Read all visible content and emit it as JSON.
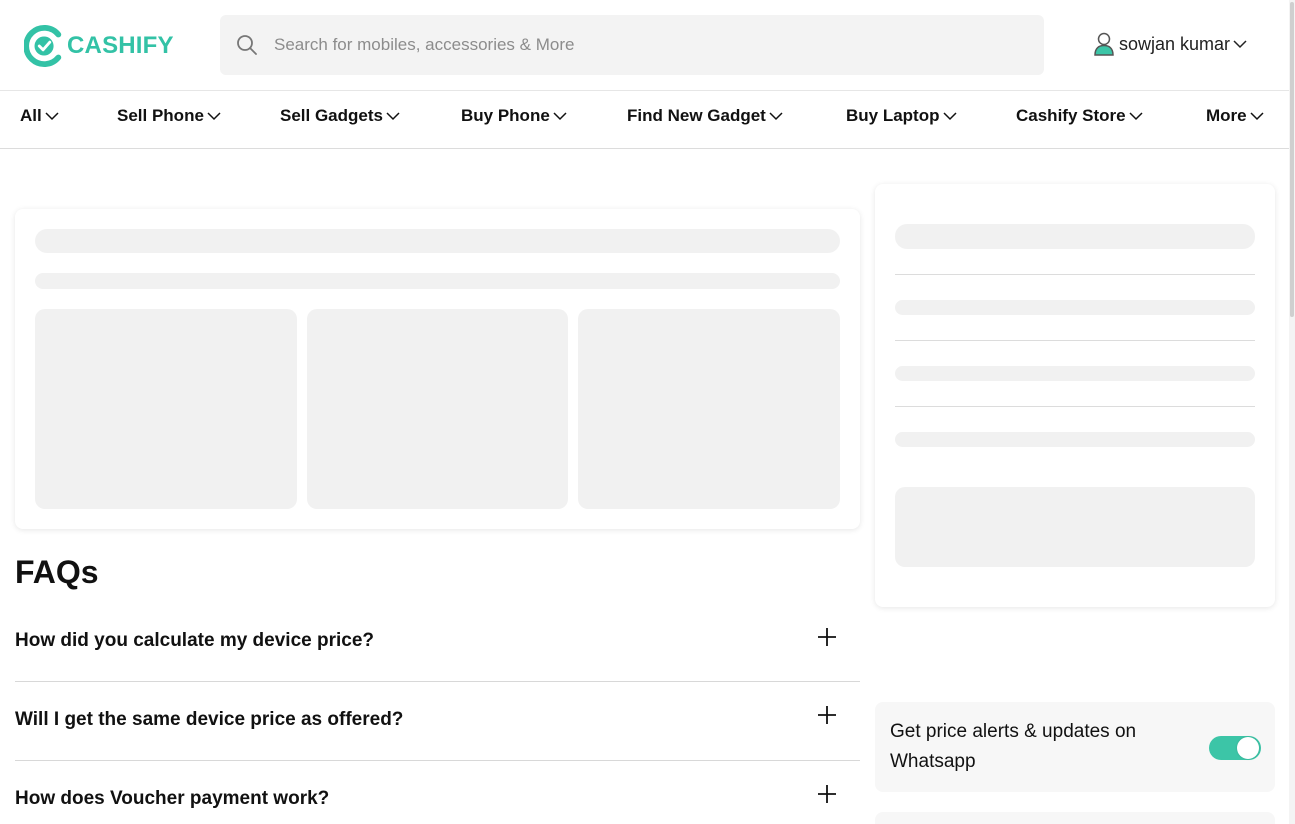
{
  "brand": {
    "name": "CASHIFY",
    "color": "#33c2a6"
  },
  "search": {
    "placeholder": "Search for mobiles, accessories & More",
    "icon": "search-icon"
  },
  "user": {
    "name": "sowjan kumar",
    "icon": "user-icon"
  },
  "nav": {
    "items": [
      {
        "label": "All"
      },
      {
        "label": "Sell Phone"
      },
      {
        "label": "Sell Gadgets"
      },
      {
        "label": "Buy Phone"
      },
      {
        "label": "Find New Gadget"
      },
      {
        "label": "Buy Laptop"
      },
      {
        "label": "Cashify Store"
      },
      {
        "label": "More"
      }
    ]
  },
  "faq": {
    "title": "FAQs",
    "questions": [
      {
        "q": "How did you calculate my device price?"
      },
      {
        "q": "Will I get the same device price as offered?"
      },
      {
        "q": "How does Voucher payment work?"
      }
    ]
  },
  "whatsapp": {
    "text": "Get price alerts & updates on Whatsapp",
    "toggle_on": true,
    "toggle_color": "#3cc5a7"
  }
}
